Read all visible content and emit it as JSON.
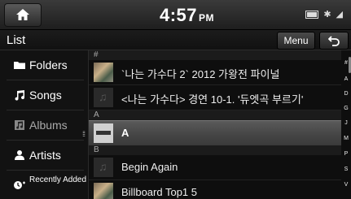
{
  "status": {
    "time": "4:57",
    "ampm": "PM",
    "icons": [
      "battery-icon",
      "bluetooth-icon",
      "signal-icon"
    ]
  },
  "header": {
    "title": "List",
    "menu_label": "Menu"
  },
  "sidebar": {
    "items": [
      {
        "label": "Folders",
        "icon": "folder-icon"
      },
      {
        "label": "Songs",
        "icon": "music-note-icon"
      },
      {
        "label": "Albums",
        "icon": "album-icon"
      },
      {
        "label": "Artists",
        "icon": "person-icon"
      },
      {
        "label": "Recently Added",
        "icon": "recently-added-icon"
      }
    ]
  },
  "list": {
    "sections": [
      {
        "letter": "#",
        "rows": [
          {
            "title": "`나는 가수다 2` 2012 가왕전 파이널"
          },
          {
            "title": "<나는 가수다> 경연 10-1. '듀엣곡 부르기'"
          }
        ]
      },
      {
        "letter": "A",
        "rows": [
          {
            "title": "A"
          }
        ]
      },
      {
        "letter": "B",
        "rows": [
          {
            "title": "Begin Again"
          },
          {
            "title": "Billboard Top1 5"
          }
        ]
      }
    ]
  },
  "index_letters": [
    "#",
    "A",
    "D",
    "G",
    "J",
    "M",
    "P",
    "S",
    "V"
  ],
  "colors": {
    "background": "#0d0d0d",
    "selected_row": "#4a4a4a",
    "text": "#ffffff"
  }
}
